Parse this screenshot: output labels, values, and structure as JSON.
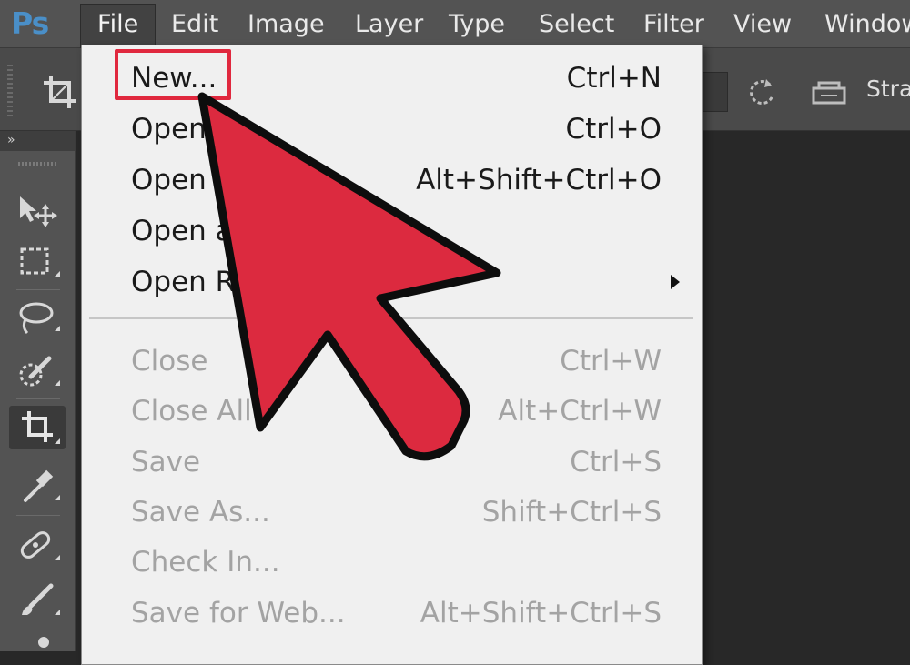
{
  "app": {
    "logo": "Ps"
  },
  "menubar": {
    "items": [
      "File",
      "Edit",
      "Image",
      "Layer",
      "Type",
      "Select",
      "Filter",
      "View",
      "Window"
    ],
    "active": "File"
  },
  "options_bar": {
    "straighten_label": "Stra"
  },
  "file_menu": {
    "group1": [
      {
        "label": "New...",
        "shortcut": "Ctrl+N",
        "enabled": true
      },
      {
        "label": "Open...",
        "shortcut": "Ctrl+O",
        "enabled": true
      },
      {
        "label": "Open in...",
        "shortcut": "Alt+Shift+Ctrl+O",
        "enabled": true
      },
      {
        "label": "Open as...",
        "shortcut": "",
        "enabled": true
      },
      {
        "label": "Open Recent",
        "shortcut": "",
        "enabled": true,
        "submenu": true
      }
    ],
    "group2": [
      {
        "label": "Close",
        "shortcut": "Ctrl+W",
        "enabled": false
      },
      {
        "label": "Close All",
        "shortcut": "Alt+Ctrl+W",
        "enabled": false
      },
      {
        "label": "Save",
        "shortcut": "Ctrl+S",
        "enabled": false
      },
      {
        "label": "Save As...",
        "shortcut": "Shift+Ctrl+S",
        "enabled": false
      },
      {
        "label": "Check In...",
        "shortcut": "",
        "enabled": false
      },
      {
        "label": "Save for Web...",
        "shortcut": "Alt+Shift+Ctrl+S",
        "enabled": false
      }
    ]
  },
  "tools": [
    "move-tool",
    "marquee-tool",
    "lasso-tool",
    "quick-selection-tool",
    "crop-tool",
    "eyedropper-tool",
    "healing-brush-tool",
    "brush-tool"
  ],
  "annotation": {
    "highlight_color": "#e0283e",
    "arrow_color": "#dc2a3f"
  },
  "colors": {
    "menubar": "#535353",
    "menu_bg": "#f0f0f0",
    "logo": "#4a8fc8"
  }
}
